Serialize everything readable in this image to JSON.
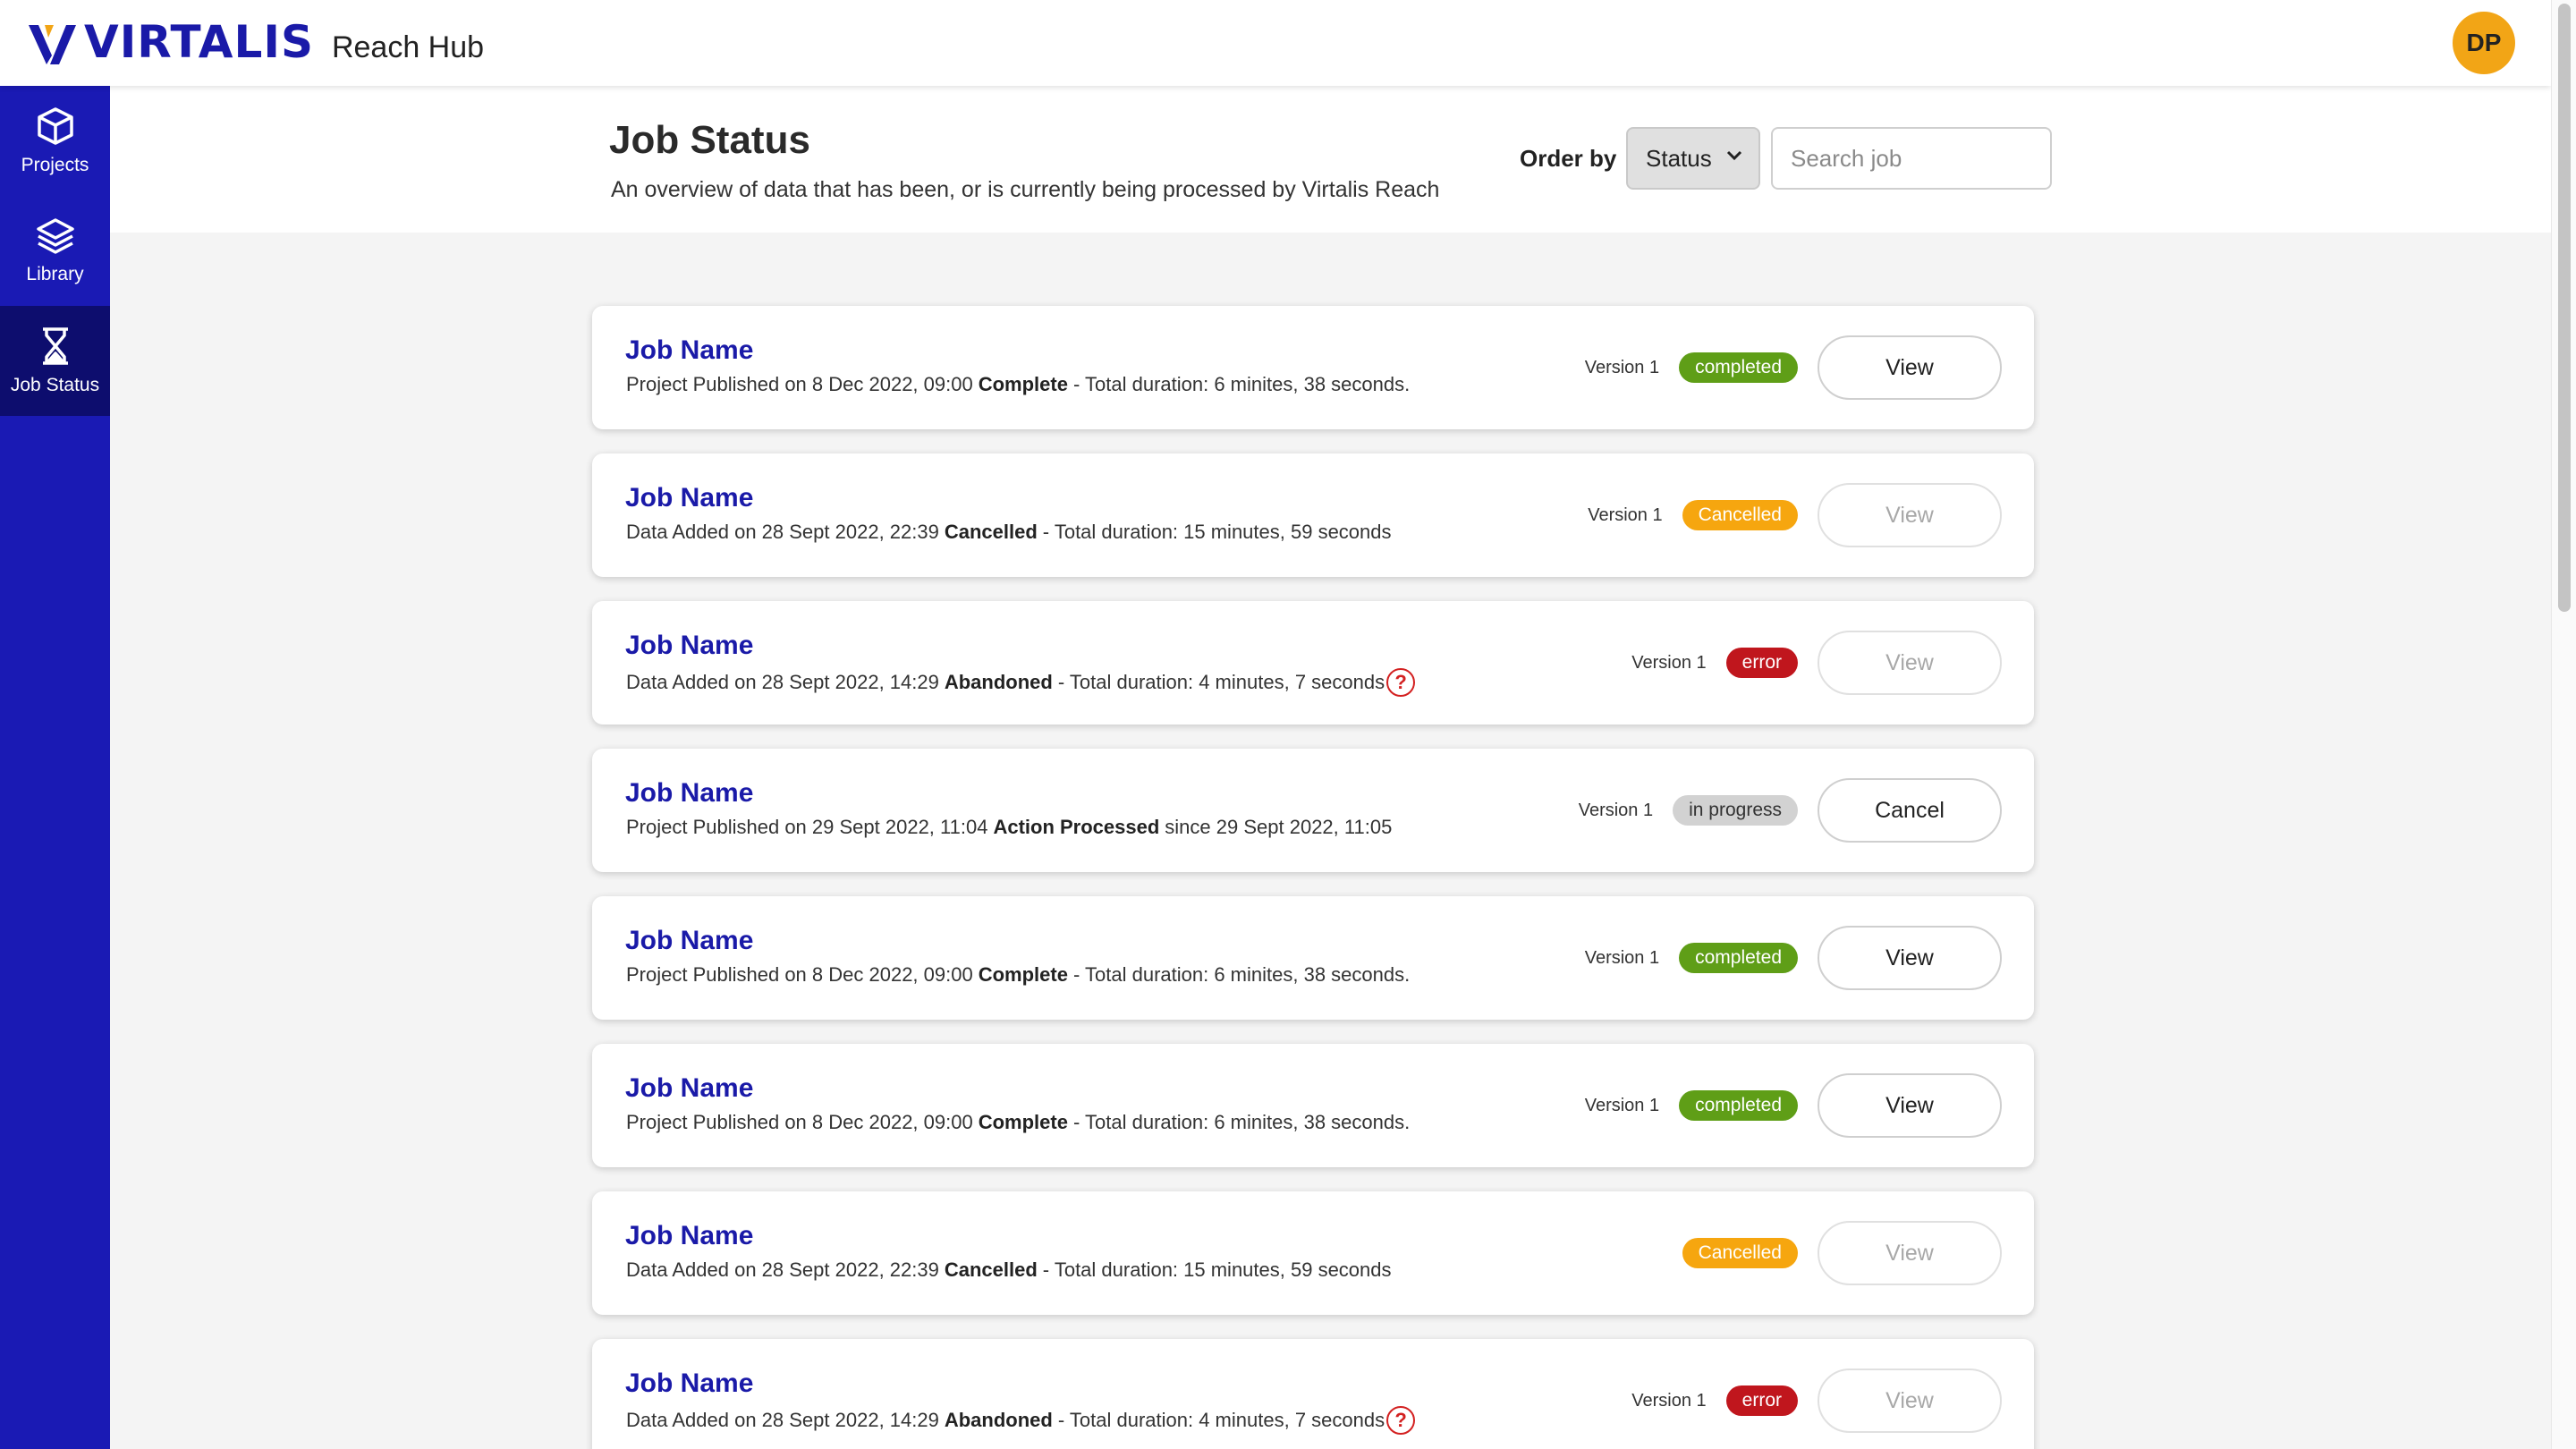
{
  "brand": {
    "logo_text": "VIRTALIS",
    "product": "Reach Hub",
    "logo_colors": [
      "#1a1aa8",
      "#f2a516"
    ]
  },
  "user": {
    "initials": "DP",
    "avatar_color": "#f2a516"
  },
  "sidebar": {
    "items": [
      {
        "label": "Projects",
        "icon": "cube-icon",
        "active": false
      },
      {
        "label": "Library",
        "icon": "layers-icon",
        "active": false
      },
      {
        "label": "Job Status",
        "icon": "hourglass-icon",
        "active": true
      }
    ]
  },
  "header": {
    "title": "Job Status",
    "subtitle": "An overview of data that has been, or is currently being processed by Virtalis Reach",
    "order_by_label": "Order by",
    "order_by_value": "Status",
    "search_placeholder": "Search job"
  },
  "jobs": [
    {
      "name": "Job Name",
      "prefix": "Project Published on 8 Dec 2022, 09:00",
      "status_text": "Complete",
      "suffix": "- Total duration: 6 minites, 38 seconds.",
      "version": "Version 1",
      "badge": "completed",
      "action": "View",
      "action_enabled": true,
      "help": false
    },
    {
      "name": "Job Name",
      "prefix": "Data Added on 28 Sept 2022, 22:39",
      "status_text": "Cancelled",
      "suffix": "- Total duration: 15 minutes, 59 seconds",
      "version": "Version 1",
      "badge": "Cancelled",
      "action": "View",
      "action_enabled": false,
      "help": false
    },
    {
      "name": "Job Name",
      "prefix": "Data Added on 28 Sept 2022, 14:29",
      "status_text": "Abandoned",
      "suffix": "- Total duration: 4 minutes, 7 seconds",
      "version": "Version 1",
      "badge": "error",
      "action": "View",
      "action_enabled": false,
      "help": true
    },
    {
      "name": "Job Name",
      "prefix": "Project Published on 29 Sept 2022, 11:04",
      "status_text": "Action Processed",
      "suffix": "since 29 Sept 2022, 11:05",
      "version": "Version 1",
      "badge": "in progress",
      "action": "Cancel",
      "action_enabled": true,
      "help": false
    },
    {
      "name": "Job Name",
      "prefix": "Project Published on 8 Dec 2022, 09:00",
      "status_text": "Complete",
      "suffix": "- Total duration: 6 minites, 38 seconds.",
      "version": "Version 1",
      "badge": "completed",
      "action": "View",
      "action_enabled": true,
      "help": false
    },
    {
      "name": "Job Name",
      "prefix": "Project Published on 8 Dec 2022, 09:00",
      "status_text": "Complete",
      "suffix": "- Total duration: 6 minites, 38 seconds.",
      "version": "Version 1",
      "badge": "completed",
      "action": "View",
      "action_enabled": true,
      "help": false
    },
    {
      "name": "Job Name",
      "prefix": "Data Added on 28 Sept 2022, 22:39",
      "status_text": "Cancelled",
      "suffix": "- Total duration: 15 minutes, 59 seconds",
      "version": "",
      "badge": "Cancelled",
      "action": "View",
      "action_enabled": false,
      "help": false
    },
    {
      "name": "Job Name",
      "prefix": "Data Added on 28 Sept 2022, 14:29",
      "status_text": "Abandoned",
      "suffix": "- Total duration: 4 minutes, 7 seconds",
      "version": "Version 1",
      "badge": "error",
      "action": "View",
      "action_enabled": false,
      "help": true
    }
  ],
  "help_glyph": "?",
  "badge_colors": {
    "completed": "#5f9e17",
    "cancelled": "#f6a60f",
    "error": "#c0161d",
    "in_progress": "#d2d2d2"
  }
}
